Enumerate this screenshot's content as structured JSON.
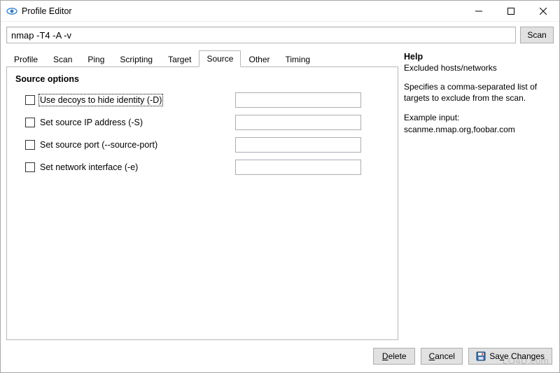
{
  "window": {
    "title": "Profile Editor"
  },
  "command": {
    "value": "nmap -T4 -A -v",
    "scan_label": "Scan"
  },
  "tabs": [
    {
      "id": "profile",
      "label": "Profile",
      "active": false
    },
    {
      "id": "scan",
      "label": "Scan",
      "active": false
    },
    {
      "id": "ping",
      "label": "Ping",
      "active": false
    },
    {
      "id": "scripting",
      "label": "Scripting",
      "active": false
    },
    {
      "id": "target",
      "label": "Target",
      "active": false
    },
    {
      "id": "source",
      "label": "Source",
      "active": true
    },
    {
      "id": "other",
      "label": "Other",
      "active": false
    },
    {
      "id": "timing",
      "label": "Timing",
      "active": false
    }
  ],
  "source_section": {
    "title": "Source options",
    "options": [
      {
        "id": "decoys",
        "label": "Use decoys to hide identity (-D)",
        "checked": false,
        "value": "",
        "focused": true
      },
      {
        "id": "srcip",
        "label": "Set source IP address (-S)",
        "checked": false,
        "value": ""
      },
      {
        "id": "srcport",
        "label": "Set source port (--source-port)",
        "checked": false,
        "value": ""
      },
      {
        "id": "iface",
        "label": "Set network interface (-e)",
        "checked": false,
        "value": ""
      }
    ]
  },
  "help": {
    "title": "Help",
    "subtitle": "Excluded hosts/networks",
    "desc": "Specifies a comma-separated list of targets to exclude from the scan.",
    "example_label": "Example input:",
    "example_value": "scanme.nmap.org,foobar.com"
  },
  "footer": {
    "delete": "Delete",
    "cancel": "Cancel",
    "save": "Save Changes"
  },
  "watermark": "LO4D.com"
}
